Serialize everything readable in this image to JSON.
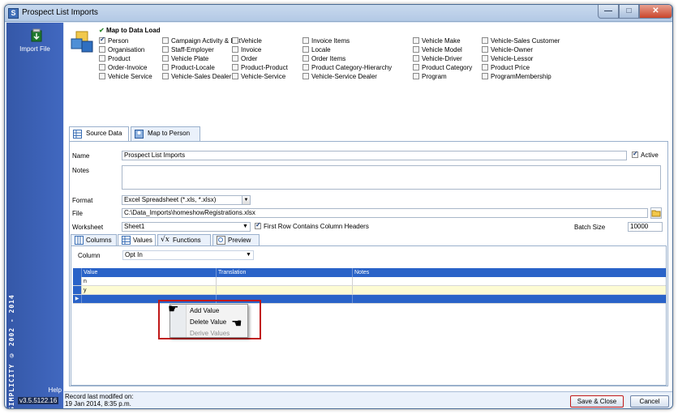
{
  "window": {
    "title": "Prospect List Imports",
    "app_icon": "S",
    "controls": {
      "minimize": "—",
      "maximize": "□",
      "close": "✕"
    }
  },
  "sidebar": {
    "import_label": "Import File",
    "brand_vertical": "SIMPLICITY © 2002 - 2014",
    "help_label": "Help",
    "version": "v3.5.5122.16"
  },
  "mapping": {
    "title": "Map to Data Load",
    "entities": [
      {
        "label": "Person",
        "checked": true
      },
      {
        "label": "Organisation",
        "checked": false
      },
      {
        "label": "Product",
        "checked": false
      },
      {
        "label": "Order-Invoice",
        "checked": false
      },
      {
        "label": "Vehicle Service",
        "checked": false
      },
      {
        "label": "Campaign Activity & List",
        "checked": false
      },
      {
        "label": "Staff-Employer",
        "checked": false
      },
      {
        "label": "Vehicle Plate",
        "checked": false
      },
      {
        "label": "Product-Locale",
        "checked": false
      },
      {
        "label": "Vehicle-Sales Dealer",
        "checked": false
      },
      {
        "label": "Vehicle",
        "checked": false
      },
      {
        "label": "Invoice",
        "checked": false
      },
      {
        "label": "Order",
        "checked": false
      },
      {
        "label": "Product-Product",
        "checked": false
      },
      {
        "label": "Vehicle-Service",
        "checked": false
      },
      {
        "label": "Invoice Items",
        "checked": false
      },
      {
        "label": "Locale",
        "checked": false
      },
      {
        "label": "Order Items",
        "checked": false
      },
      {
        "label": "Product Category-Hierarchy",
        "checked": false
      },
      {
        "label": "Vehicle-Service Dealer",
        "checked": false
      },
      {
        "label": "Vehicle Make",
        "checked": false
      },
      {
        "label": "Vehicle Model",
        "checked": false
      },
      {
        "label": "Vehicle-Driver",
        "checked": false
      },
      {
        "label": "Product Category",
        "checked": false
      },
      {
        "label": "Program",
        "checked": false
      },
      {
        "label": "Vehicle-Sales Customer",
        "checked": false
      },
      {
        "label": "Vehicle-Owner",
        "checked": false
      },
      {
        "label": "Vehicle-Lessor",
        "checked": false
      },
      {
        "label": "Product Price",
        "checked": false
      },
      {
        "label": "ProgramMembership",
        "checked": false
      }
    ]
  },
  "tabs": [
    "Source Data",
    "Map to Person"
  ],
  "form": {
    "name_label": "Name",
    "name_value": "Prospect List Imports",
    "active_label": "Active",
    "active_checked": true,
    "notes_label": "Notes",
    "notes_value": "",
    "format_label": "Format",
    "format_value": "Excel Spreadsheet (*.xls, *.xlsx)",
    "file_label": "File",
    "file_value": "C:\\Data_Imports\\homeshowRegistrations.xlsx",
    "worksheet_label": "Worksheet",
    "worksheet_value": "Sheet1",
    "first_row_label": "First Row Contains Column Headers",
    "first_row_checked": true,
    "batch_label": "Batch Size",
    "batch_value": "10000"
  },
  "subtabs": [
    "Columns",
    "Values",
    "Functions",
    "Preview"
  ],
  "values_panel": {
    "column_label": "Column",
    "column_value": "Opt In",
    "headers": [
      "Value",
      "Translation",
      "Notes"
    ],
    "rows": [
      {
        "value": "n",
        "translation": "",
        "notes": ""
      },
      {
        "value": "y",
        "translation": "",
        "notes": ""
      },
      {
        "value": "",
        "translation": "",
        "notes": ""
      }
    ]
  },
  "context_menu": {
    "items": [
      {
        "label": "Add Value",
        "enabled": true
      },
      {
        "label": "Delete Value",
        "enabled": true
      },
      {
        "label": "Derive Values",
        "enabled": false
      }
    ]
  },
  "status": {
    "line1": "Record last modifed on:",
    "line2": "19 Jan 2014, 8:35 p.m.",
    "save_close": "Save & Close",
    "cancel": "Cancel"
  },
  "colors": {
    "accent": "#2a63c8",
    "sidebar": "#3a5fb2",
    "highlight": "#c01818",
    "selected_row": "#fdfbd4"
  }
}
